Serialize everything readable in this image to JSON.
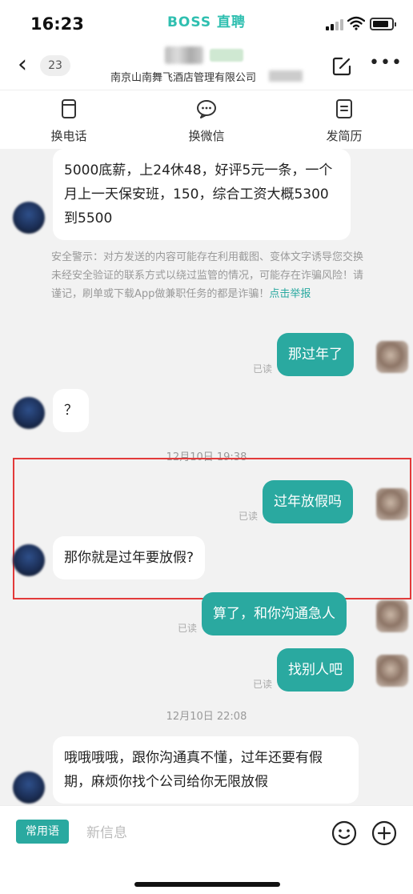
{
  "status_bar": {
    "time": "16:23",
    "app_brand": "BOSS 直聘"
  },
  "header": {
    "unread_count": "23",
    "company": "南京山南舞飞酒店管理有限公司"
  },
  "actions": [
    {
      "label": "换电话",
      "icon": "phone-icon"
    },
    {
      "label": "换微信",
      "icon": "wechat-icon"
    },
    {
      "label": "发简历",
      "icon": "resume-icon"
    }
  ],
  "messages": {
    "m1": "5000底薪，上24休48，好评5元一条，一个月上一天保安班，150，综合工资大概5300到5500",
    "warning": "安全警示：对方发送的内容可能存在利用截图、变体文字诱导您交换未经安全验证的联系方式以绕过监管的情况，可能存在诈骗风险！请谨记，刷单或下载App做兼职任务的都是诈骗！",
    "warning_link": "点击举报",
    "m2": "那过年了",
    "m3": "？",
    "stamp1": "12月10日 19:38",
    "m4": "过年放假吗",
    "m5": "那你就是过年要放假?",
    "m6": "算了，和你沟通急人",
    "m7": "找别人吧",
    "stamp2": "12月10日 22:08",
    "m8": "哦哦哦哦，跟你沟通真不懂，过年还要有假期，麻烦你找个公司给你无限放假",
    "read_label": "已读"
  },
  "input_bar": {
    "phrases_label": "常用语",
    "placeholder": "新信息"
  }
}
